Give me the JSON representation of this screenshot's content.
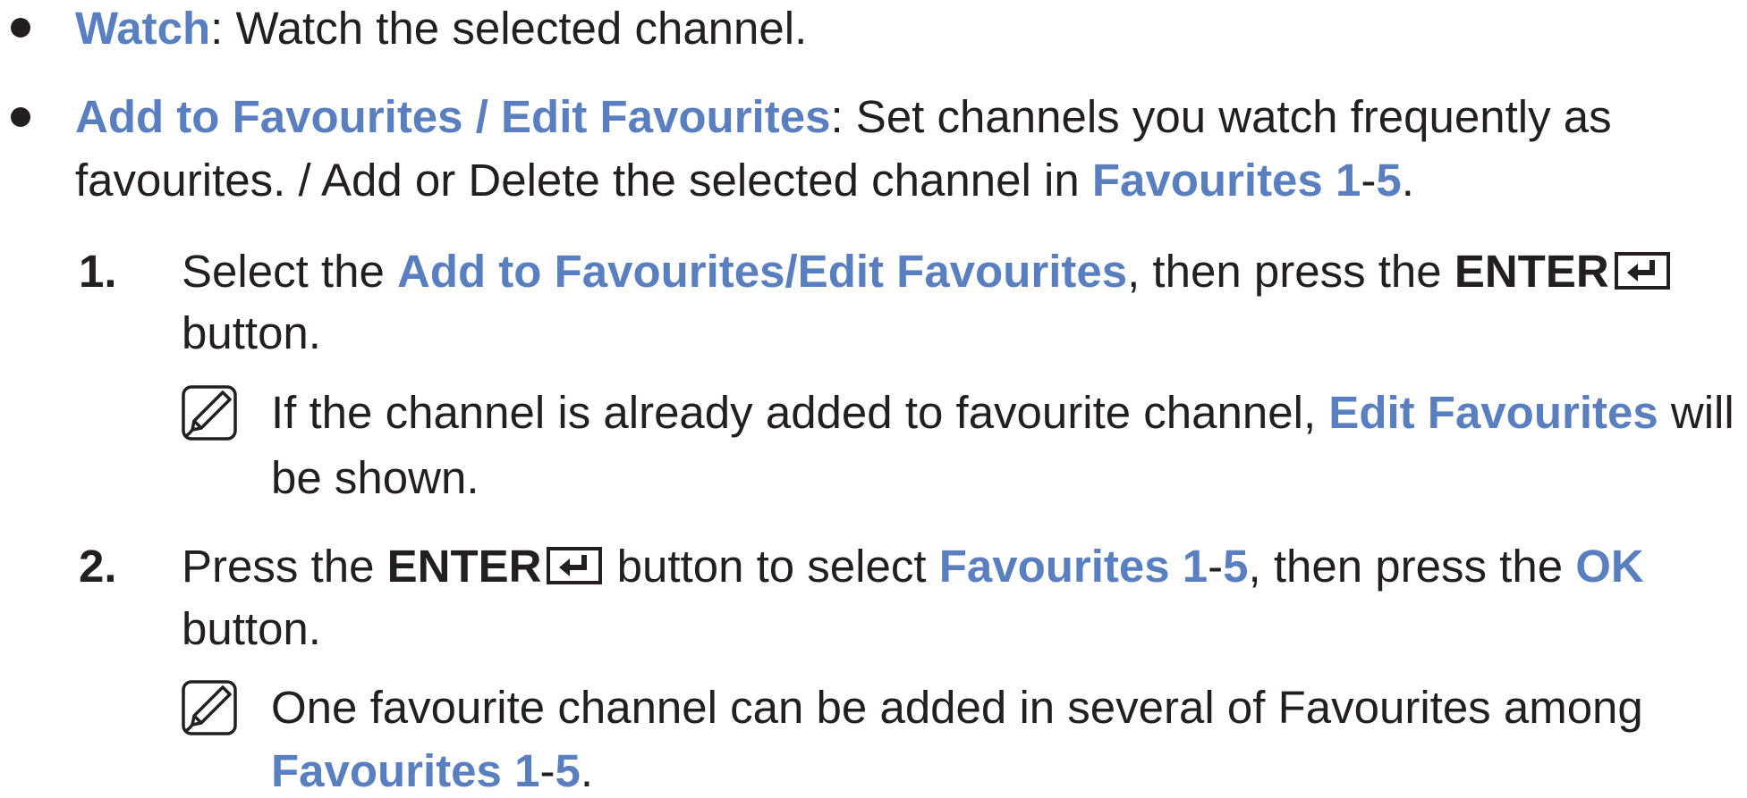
{
  "items": [
    {
      "term": "Watch",
      "sep": ": ",
      "desc": "Watch the selected channel."
    },
    {
      "term": "Add to Favourites / Edit Favourites",
      "sep": ": ",
      "desc_line1": "Set channels you watch frequently as",
      "desc_line2_a": "favourites. / Add or Delete the selected channel in ",
      "desc_line2_fav": "Favourites 1",
      "desc_line2_dash": "-",
      "desc_line2_five": "5",
      "desc_line2_end": "."
    }
  ],
  "steps": [
    {
      "number": "1.",
      "a": "Select the ",
      "target": "Add to Favourites/Edit Favourites",
      "b": ", then press the ",
      "key": "ENTER",
      "cont": "button.",
      "note_a": "If the channel is already added to favourite channel, ",
      "note_hl": "Edit Favourites",
      "note_b": " will",
      "note_cont": "be shown."
    },
    {
      "number": "2.",
      "a": "Press the ",
      "key": "ENTER",
      "b": " button to select ",
      "fav": "Favourites 1",
      "dash": "-",
      "five": "5",
      "c": ", then press the ",
      "ok": "OK",
      "cont": "button.",
      "note_a": "One favourite channel can be added in several of Favourites among",
      "note_fav": "Favourites 1",
      "note_dash": "-",
      "note_five": "5",
      "note_end": "."
    }
  ],
  "icons": {
    "enter": "enter-icon",
    "note": "note-icon"
  },
  "colors": {
    "highlight": "#5a7fc0",
    "text": "#231f20"
  }
}
